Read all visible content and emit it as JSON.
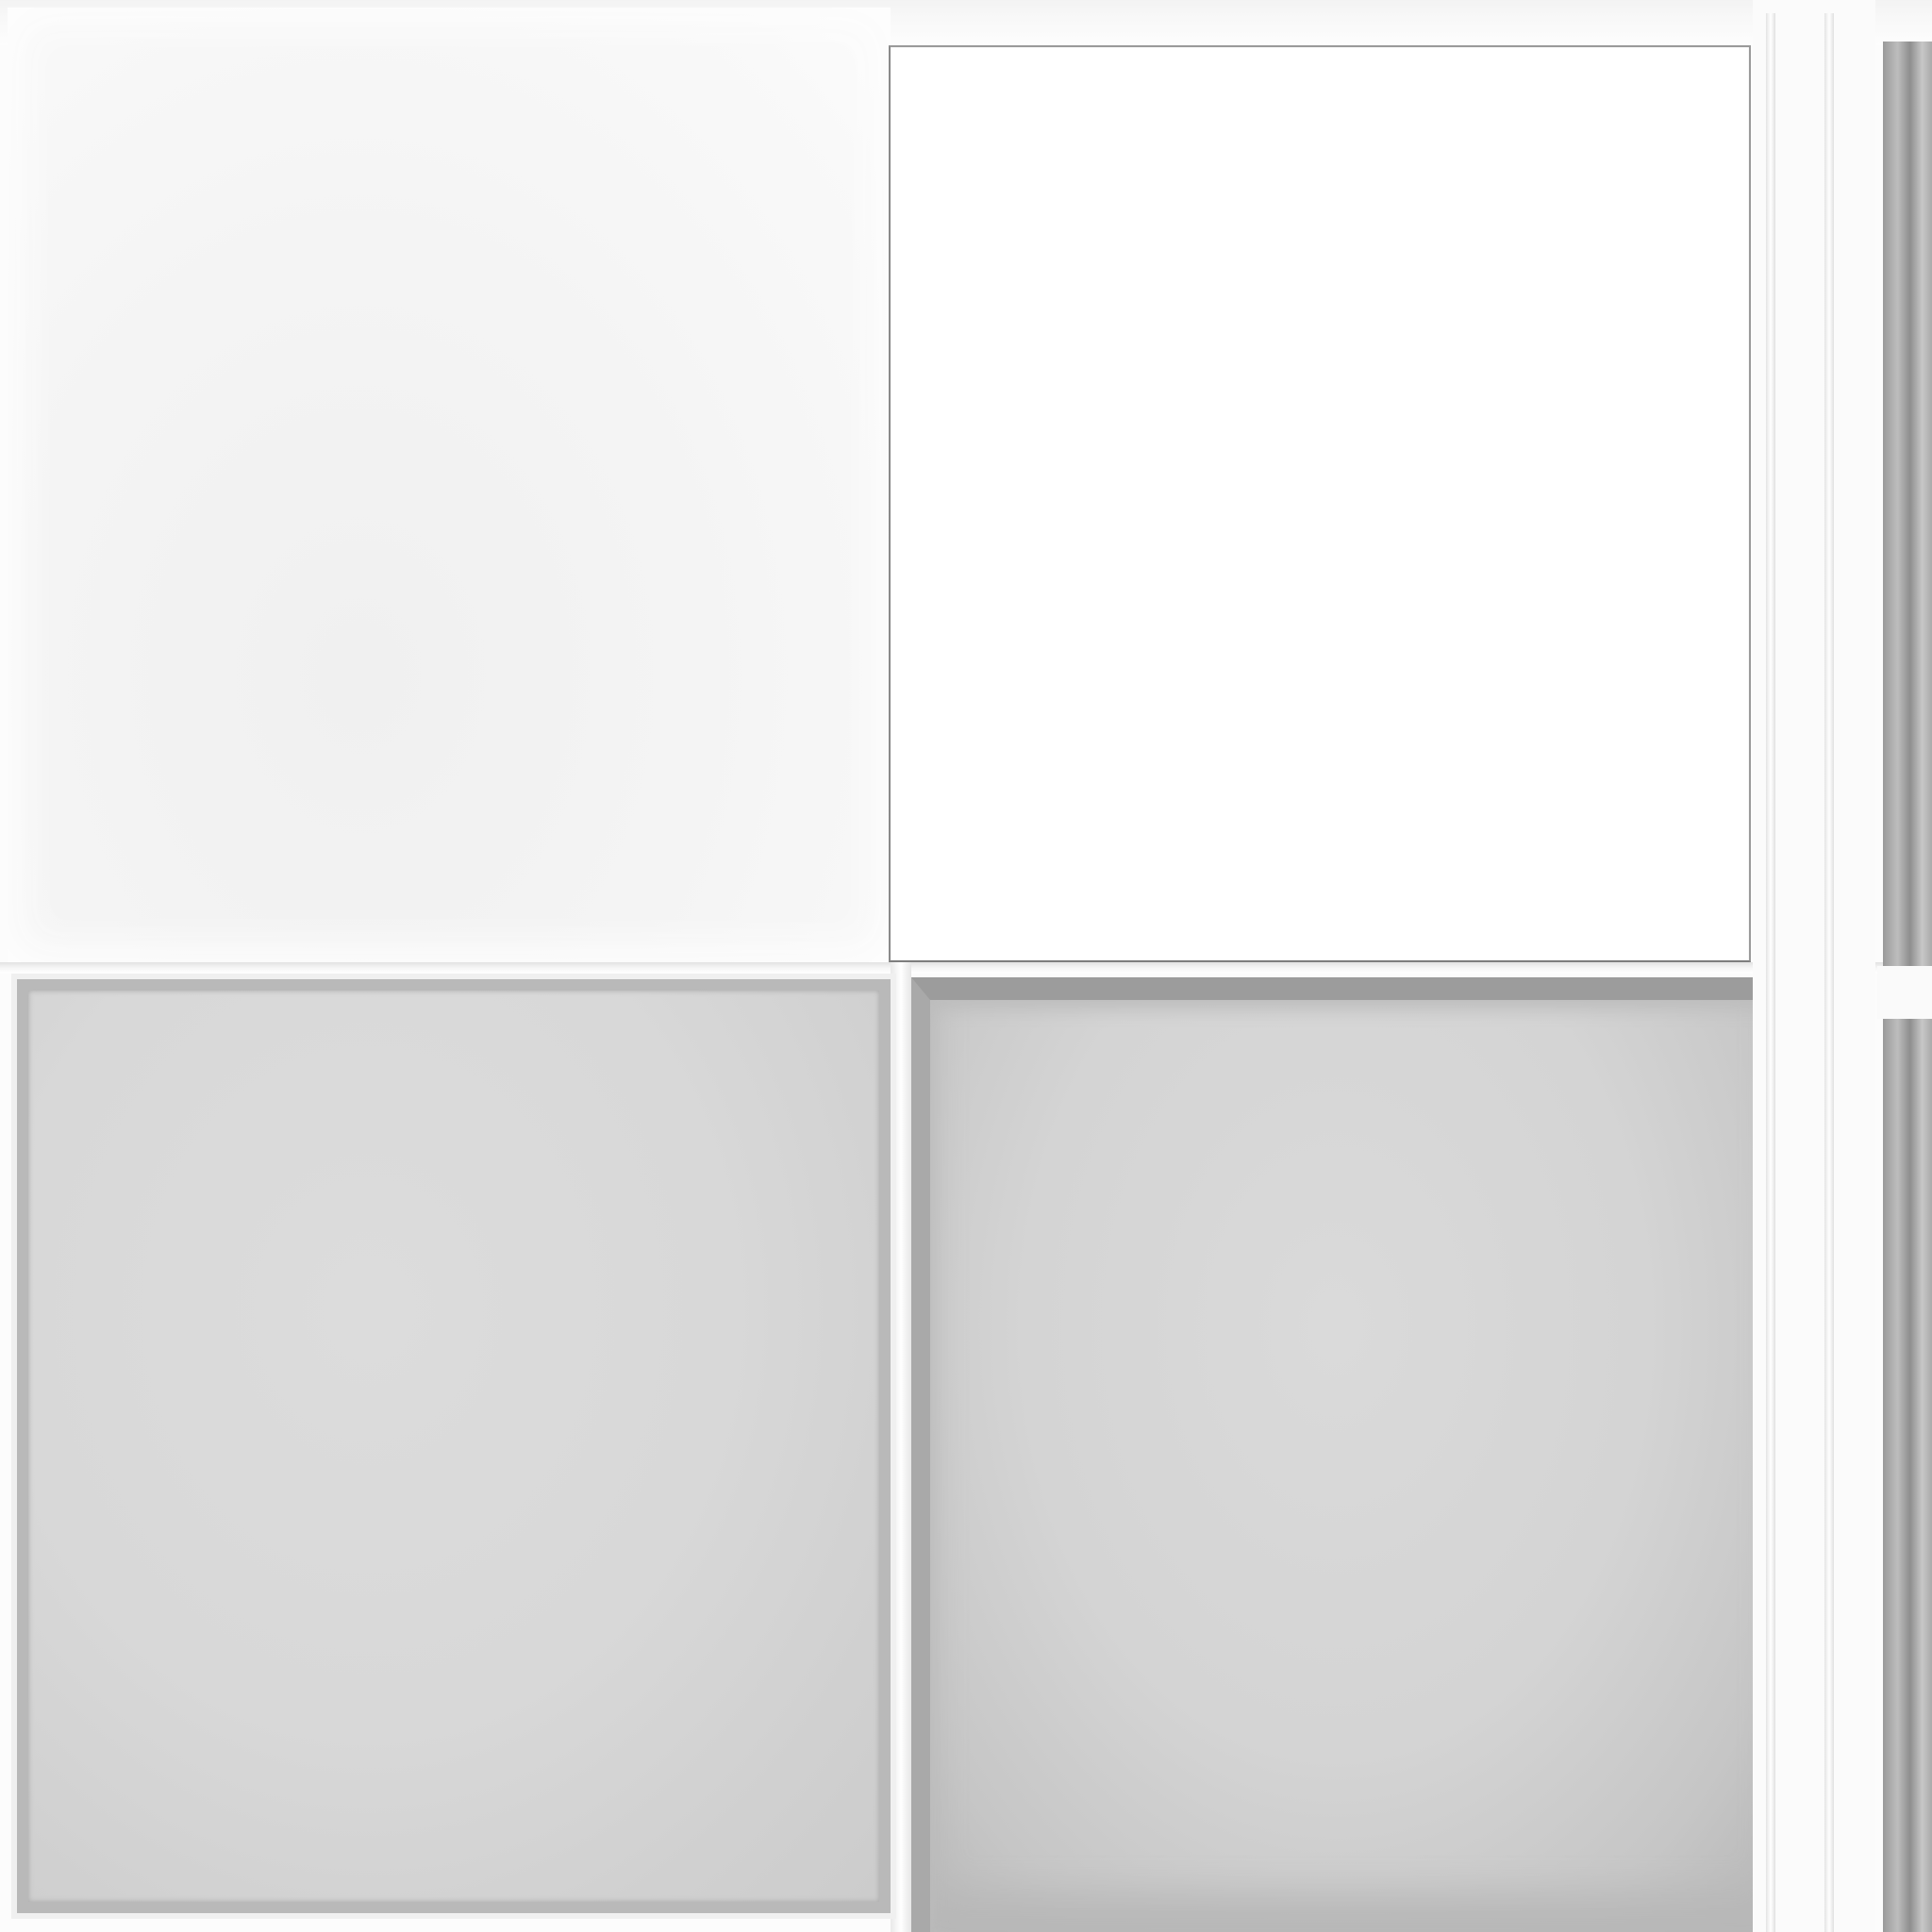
{
  "colors": {
    "background": "#fcfcfc",
    "tile_top_left": "#f4f4f4",
    "tile_top_right": "#ffffff",
    "tile_bottom_left": "#d8d8d8",
    "tile_bottom_right": "#d4d4d4",
    "border_dark": "#8a8a8a"
  }
}
